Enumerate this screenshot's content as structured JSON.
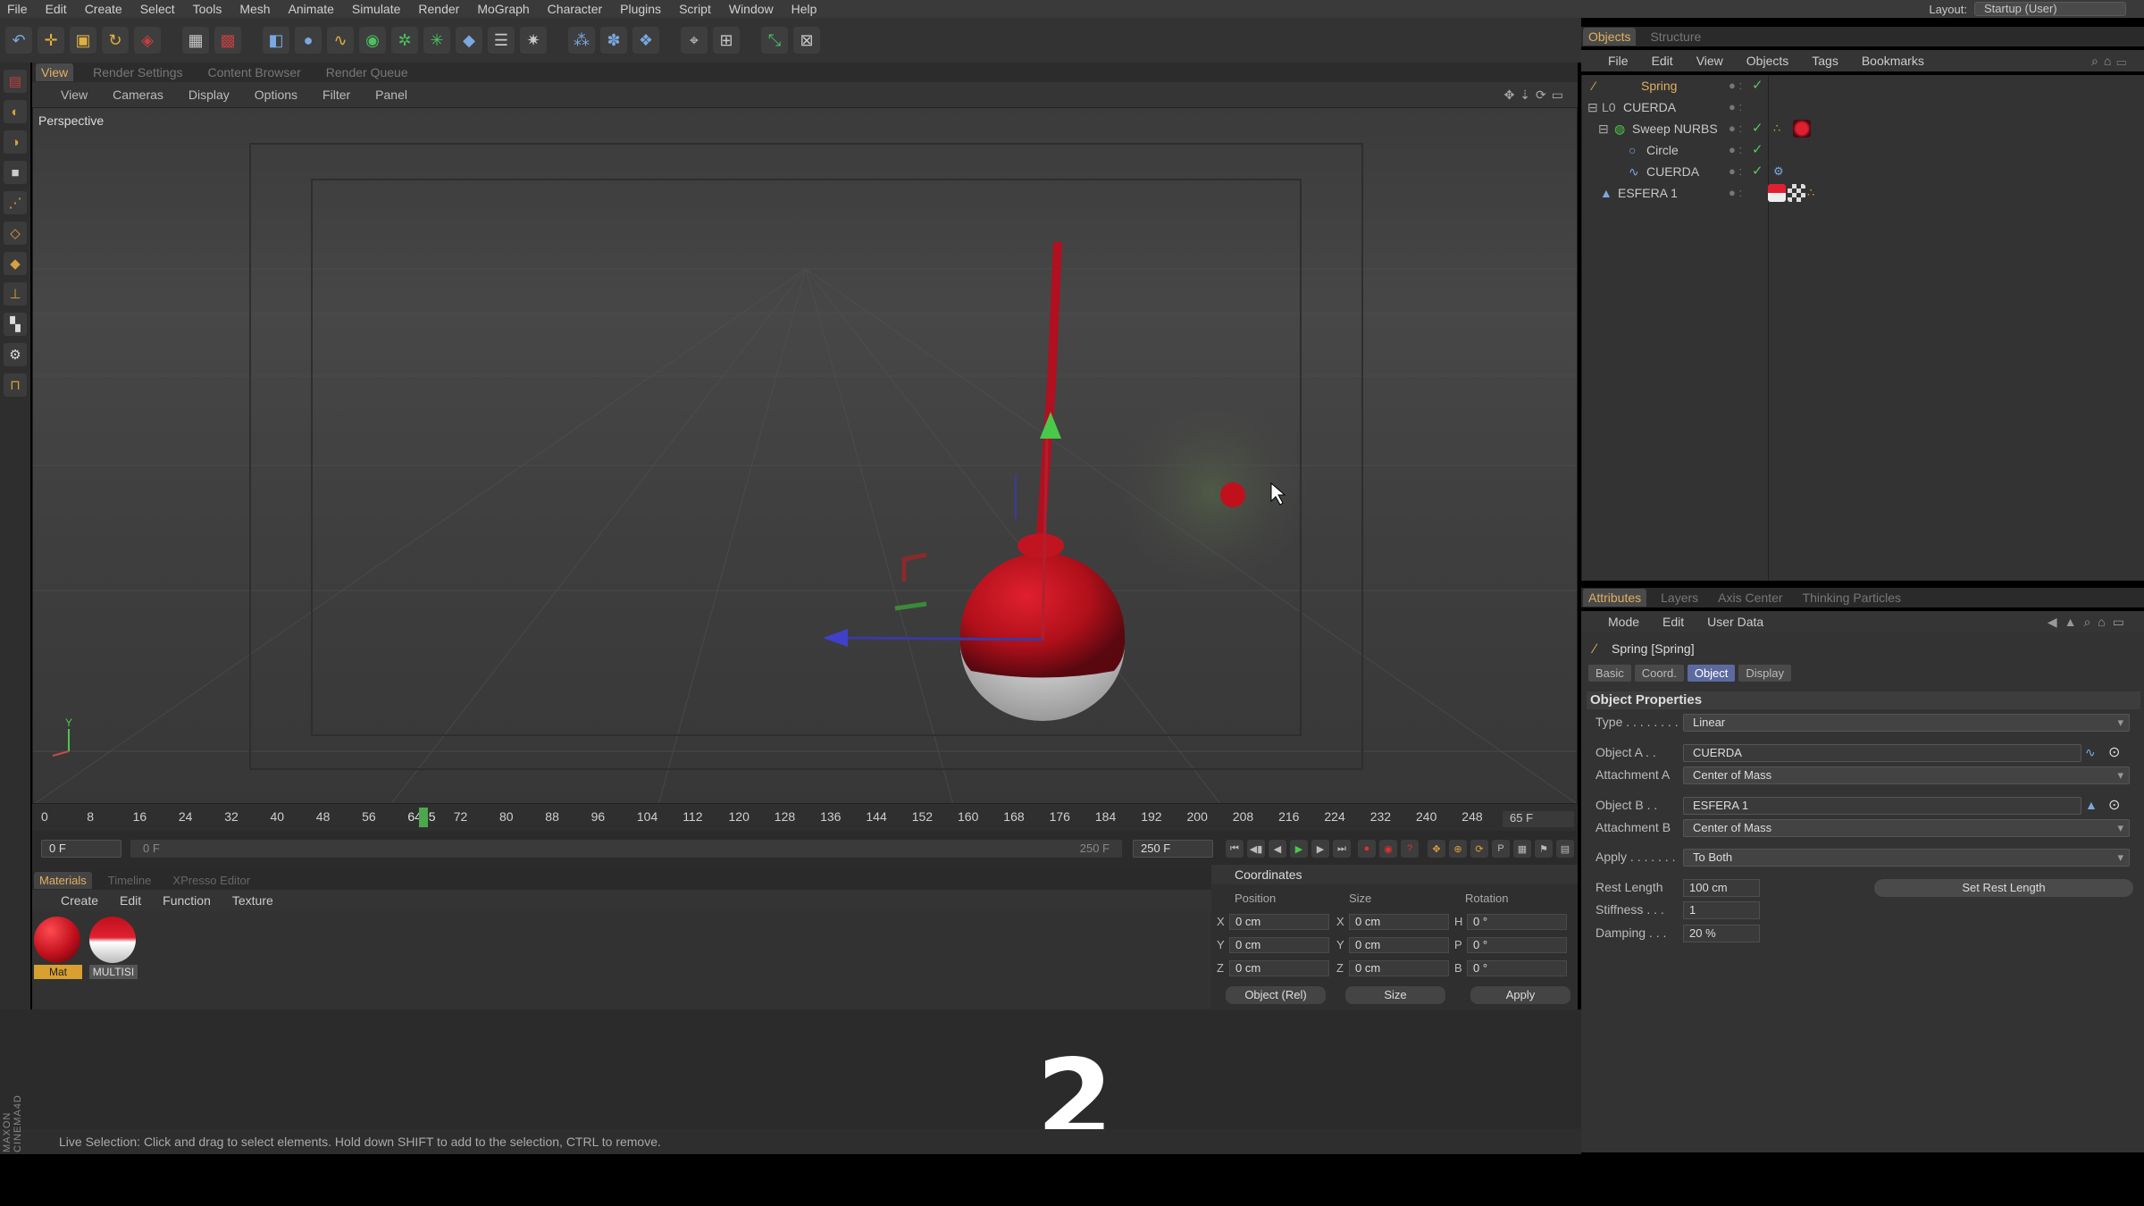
{
  "menubar": {
    "items": [
      "File",
      "Edit",
      "Create",
      "Select",
      "Tools",
      "Mesh",
      "Animate",
      "Simulate",
      "Render",
      "MoGraph",
      "Character",
      "Plugins",
      "Script",
      "Window",
      "Help"
    ],
    "layout_label": "Layout:",
    "layout_value": "Startup (User)"
  },
  "viewport": {
    "tabs": [
      "View",
      "Render Settings",
      "Content Browser",
      "Render Queue"
    ],
    "menu": [
      "View",
      "Cameras",
      "Display",
      "Options",
      "Filter",
      "Panel"
    ],
    "label": "Perspective",
    "axis_y": "Y"
  },
  "timeline": {
    "ticks": [
      "0",
      "8",
      "16",
      "24",
      "32",
      "40",
      "48",
      "56",
      "6465",
      "72",
      "80",
      "88",
      "96",
      "104",
      "112",
      "120",
      "128",
      "136",
      "144",
      "152",
      "160",
      "168",
      "176",
      "184",
      "192",
      "200",
      "208",
      "216",
      "224",
      "232",
      "240",
      "248"
    ],
    "current_frame_label": "65 F",
    "current_frame": 65,
    "start_field": "0 F",
    "scrub_start": "0 F",
    "scrub_end": "250 F",
    "end_field": "250 F"
  },
  "materials": {
    "tabs": [
      "Materials",
      "Timeline",
      "XPresso Editor"
    ],
    "menu": [
      "Create",
      "Edit",
      "Function",
      "Texture"
    ],
    "items": [
      {
        "label": "Mat",
        "color": "#c0101c"
      },
      {
        "label": "MULTISI",
        "color": "#d01820"
      }
    ]
  },
  "coordinates": {
    "title": "Coordinates",
    "headers": [
      "Position",
      "Size",
      "Rotation"
    ],
    "rows": [
      {
        "axis": "X",
        "pos": "0 cm",
        "size_axis": "X",
        "size": "0 cm",
        "rot_axis": "H",
        "rot": "0 °"
      },
      {
        "axis": "Y",
        "pos": "0 cm",
        "size_axis": "Y",
        "size": "0 cm",
        "rot_axis": "P",
        "rot": "0 °"
      },
      {
        "axis": "Z",
        "pos": "0 cm",
        "size_axis": "Z",
        "size": "0 cm",
        "rot_axis": "B",
        "rot": "0 °"
      }
    ],
    "mode_select": "Object (Rel)",
    "size_select": "Size",
    "apply_label": "Apply"
  },
  "overlay": {
    "big_number": "2"
  },
  "status": {
    "text": "Live Selection: Click and drag to select elements. Hold down SHIFT to add to the selection, CTRL to remove.",
    "brand": "MAXON CINEMA4D"
  },
  "objects": {
    "tabs": [
      "Objects",
      "Structure"
    ],
    "menu": [
      "File",
      "Edit",
      "View",
      "Objects",
      "Tags",
      "Bookmarks"
    ],
    "tree": [
      {
        "name": "Spring",
        "color": "#e0b060"
      },
      {
        "name": "CUERDA",
        "color": "#cccccc"
      },
      {
        "name": "Sweep NURBS",
        "color": "#cccccc"
      },
      {
        "name": "Circle",
        "color": "#cccccc"
      },
      {
        "name": "CUERDA",
        "color": "#cccccc"
      },
      {
        "name": "ESFERA 1",
        "color": "#cccccc"
      }
    ]
  },
  "attributes": {
    "tabs": [
      "Attributes",
      "Layers",
      "Axis Center",
      "Thinking Particles"
    ],
    "menu": [
      "Mode",
      "Edit",
      "User Data"
    ],
    "title": "Spring [Spring]",
    "subtabs": [
      "Basic",
      "Coord.",
      "Object",
      "Display"
    ],
    "section": "Object Properties",
    "type_label": "Type . . . . . . . .",
    "type_value": "Linear",
    "object_a_label": "Object A . .",
    "object_a_value": "CUERDA",
    "attach_a_label": "Attachment A",
    "attach_a_value": "Center of Mass",
    "object_b_label": "Object B . .",
    "object_b_value": "ESFERA 1",
    "attach_b_label": "Attachment B",
    "attach_b_value": "Center of Mass",
    "apply_label": "Apply . . . . . . .",
    "apply_value": "To Both",
    "rest_label": "Rest Length",
    "rest_value": "100 cm",
    "set_rest_label": "Set Rest Length",
    "stiffness_label": "Stiffness . . .",
    "stiffness_value": "1",
    "damping_label": "Damping . . .",
    "damping_value": "20 %"
  }
}
